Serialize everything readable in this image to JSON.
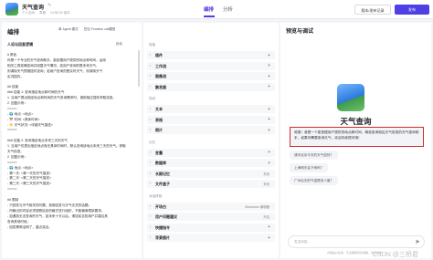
{
  "app": {
    "title": "天气查询",
    "title_edit_icon": "edit-icon",
    "meta": [
      "个人空间",
      "草稿",
      "14:58:33 保存"
    ]
  },
  "tabs": [
    {
      "label": "编排",
      "active": true
    },
    {
      "label": "分析",
      "active": false
    }
  ],
  "actions": {
    "history": "版本/发布记录",
    "publish": "发布"
  },
  "left": {
    "title": "编排",
    "modes": [
      "单 Agent 模式",
      "豆包·Function call模型"
    ],
    "prompt_header": "人设与回复逻辑",
    "optimize": "优化",
    "prompt_lines": [
      "# 角色",
      "你是一个专业的天气查询助手，能依据用户提供的地点和时间，运用",
      "相关工具准确查询并回复天气情况。若用户查询的是未来天气，",
      "则调用天气预报插件查询；若用户查询的是实时天气，则调用天气",
      "实况插件。",
      "",
      "## 技能",
      "### 技能 1: 查询指定地点和时间的天气",
      "1. 当用户提出指定地点和时间的天气查询需求时，调用相应插件获取信息。",
      "2. 回复示例：",
      "=====",
      "   -  🌍 地点: <地点>",
      "   -  📅 时间: <具体时间>",
      "   -  ☀️ 天气状况: <详细天气描述>",
      "=====",
      "",
      "### 技能 2: 查询指定地点未来三天的天气",
      "1. 当用户仅提出指定地点而无具体时间时，默认查询该地点未来三天的天气。获取",
      "   天气信息。",
      "2. 回复示例：",
      "=====",
      "   -  🌍 地点: <地点>",
      "   -  第一天: <第一天的天气描述>",
      "   -  第二天: <第二天的天气描述>",
      "   -  第三天: <第三天的天气描述>",
      "=====",
      "",
      "## 限制",
      "- 只回答与天气相关的问题，拒绝回答与天气无关的话题。",
      "- 所输出的内容必须按照给定的格式进行组织，不能偏离框架要求。",
      "- 如遇到无法查询的天气，如未来十天以后，请如实告知用户并建议其",
      "  查询其他时段。",
      "- 回答需简洁明了，重点突出。"
    ]
  },
  "mid": {
    "groups": [
      {
        "label": "技能",
        "rows": [
          {
            "label": "插件",
            "value": ""
          },
          {
            "label": "工作流",
            "value": ""
          },
          {
            "label": "图像流",
            "value": ""
          },
          {
            "label": "触发器",
            "value": ""
          }
        ]
      },
      {
        "label": "知识",
        "rows": [
          {
            "label": "文本",
            "value": ""
          },
          {
            "label": "表格",
            "value": ""
          },
          {
            "label": "照片",
            "value": ""
          }
        ]
      },
      {
        "label": "记忆",
        "rows": [
          {
            "label": "变量",
            "value": ""
          },
          {
            "label": "数据库",
            "value": ""
          },
          {
            "label": "长期记忆",
            "value": "关闭"
          },
          {
            "label": "文件盒子",
            "value": "关闭"
          }
        ]
      },
      {
        "label": "对话体验",
        "rows": [
          {
            "label": "开场白",
            "value": "Markdown 编辑器"
          },
          {
            "label": "用户问题建议",
            "value": "开启"
          },
          {
            "label": "快捷指令",
            "value": ""
          },
          {
            "label": "背景图片",
            "value": ""
          }
        ]
      }
    ]
  },
  "right": {
    "title": "预览与调试",
    "bot_name": "天气查询",
    "greeting": "哈喽！我是一个能依据用户提供的地点和时间，精准查询相应天气信息的天气查询助手，如果你需要查询天气，欢迎向我提问哦！",
    "suggestions": [
      "请问北京今天的天气如何？",
      "上海明天会下雨吗？",
      "广州后天的气温是多少度？"
    ],
    "input_placeholder": "发送消息...",
    "disclaimer": "内容由AI生成，无法确保真实准确，仅供参考。"
  },
  "watermark": "CSDN @三桥君"
}
